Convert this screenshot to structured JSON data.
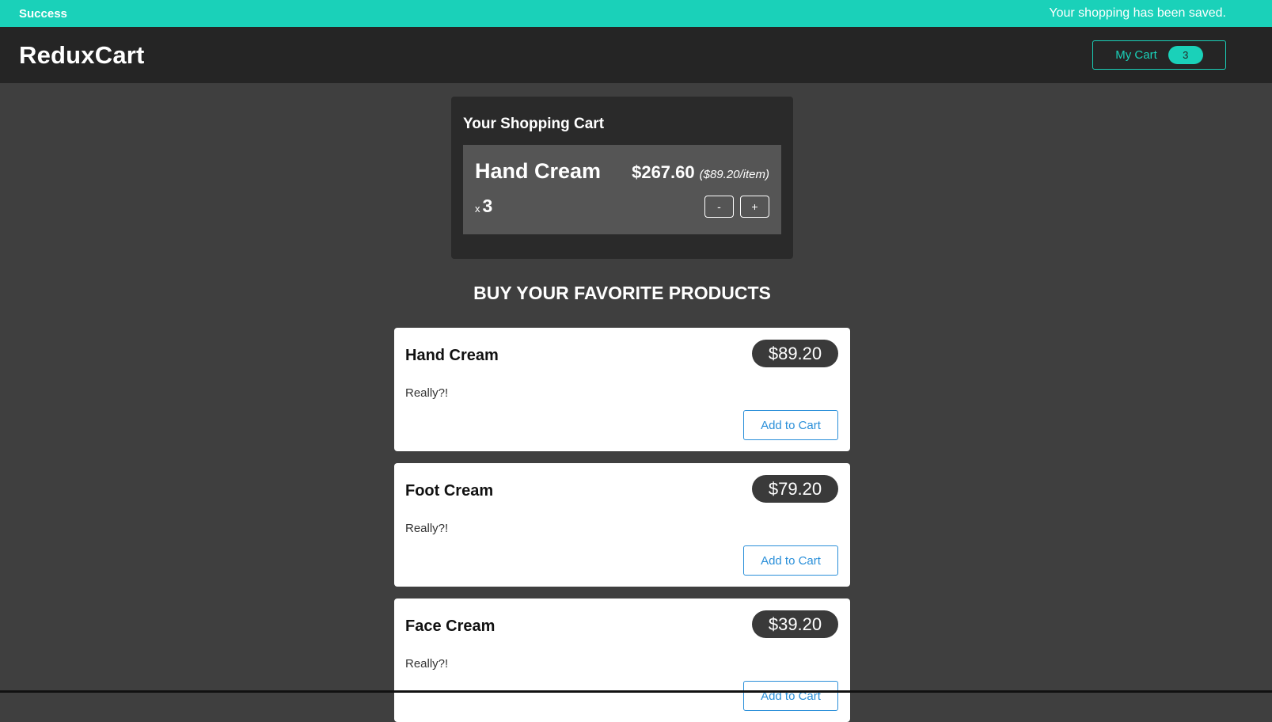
{
  "notification": {
    "title": "Success",
    "message": "Your shopping has been saved."
  },
  "header": {
    "logo": "ReduxCart",
    "cart_button_label": "My Cart",
    "cart_count": "3"
  },
  "cart": {
    "heading": "Your Shopping Cart",
    "items": [
      {
        "name": "Hand Cream",
        "total": "$267.60",
        "per_item": "($89.20/item)",
        "qty_prefix": "x",
        "quantity": "3",
        "decrement_label": "-",
        "increment_label": "+"
      }
    ]
  },
  "products_section": {
    "title": "BUY YOUR FAVORITE PRODUCTS",
    "products": [
      {
        "name": "Hand Cream",
        "price": "$89.20",
        "description": "Really?!",
        "button": "Add to Cart"
      },
      {
        "name": "Foot Cream",
        "price": "$79.20",
        "description": "Really?!",
        "button": "Add to Cart"
      },
      {
        "name": "Face Cream",
        "price": "$39.20",
        "description": "Really?!",
        "button": "Add to Cart"
      }
    ]
  },
  "colors": {
    "accent": "#1ad1b9",
    "header_bg": "#252525",
    "page_bg": "#3f3f3f",
    "button_blue": "#2a8fd9"
  }
}
